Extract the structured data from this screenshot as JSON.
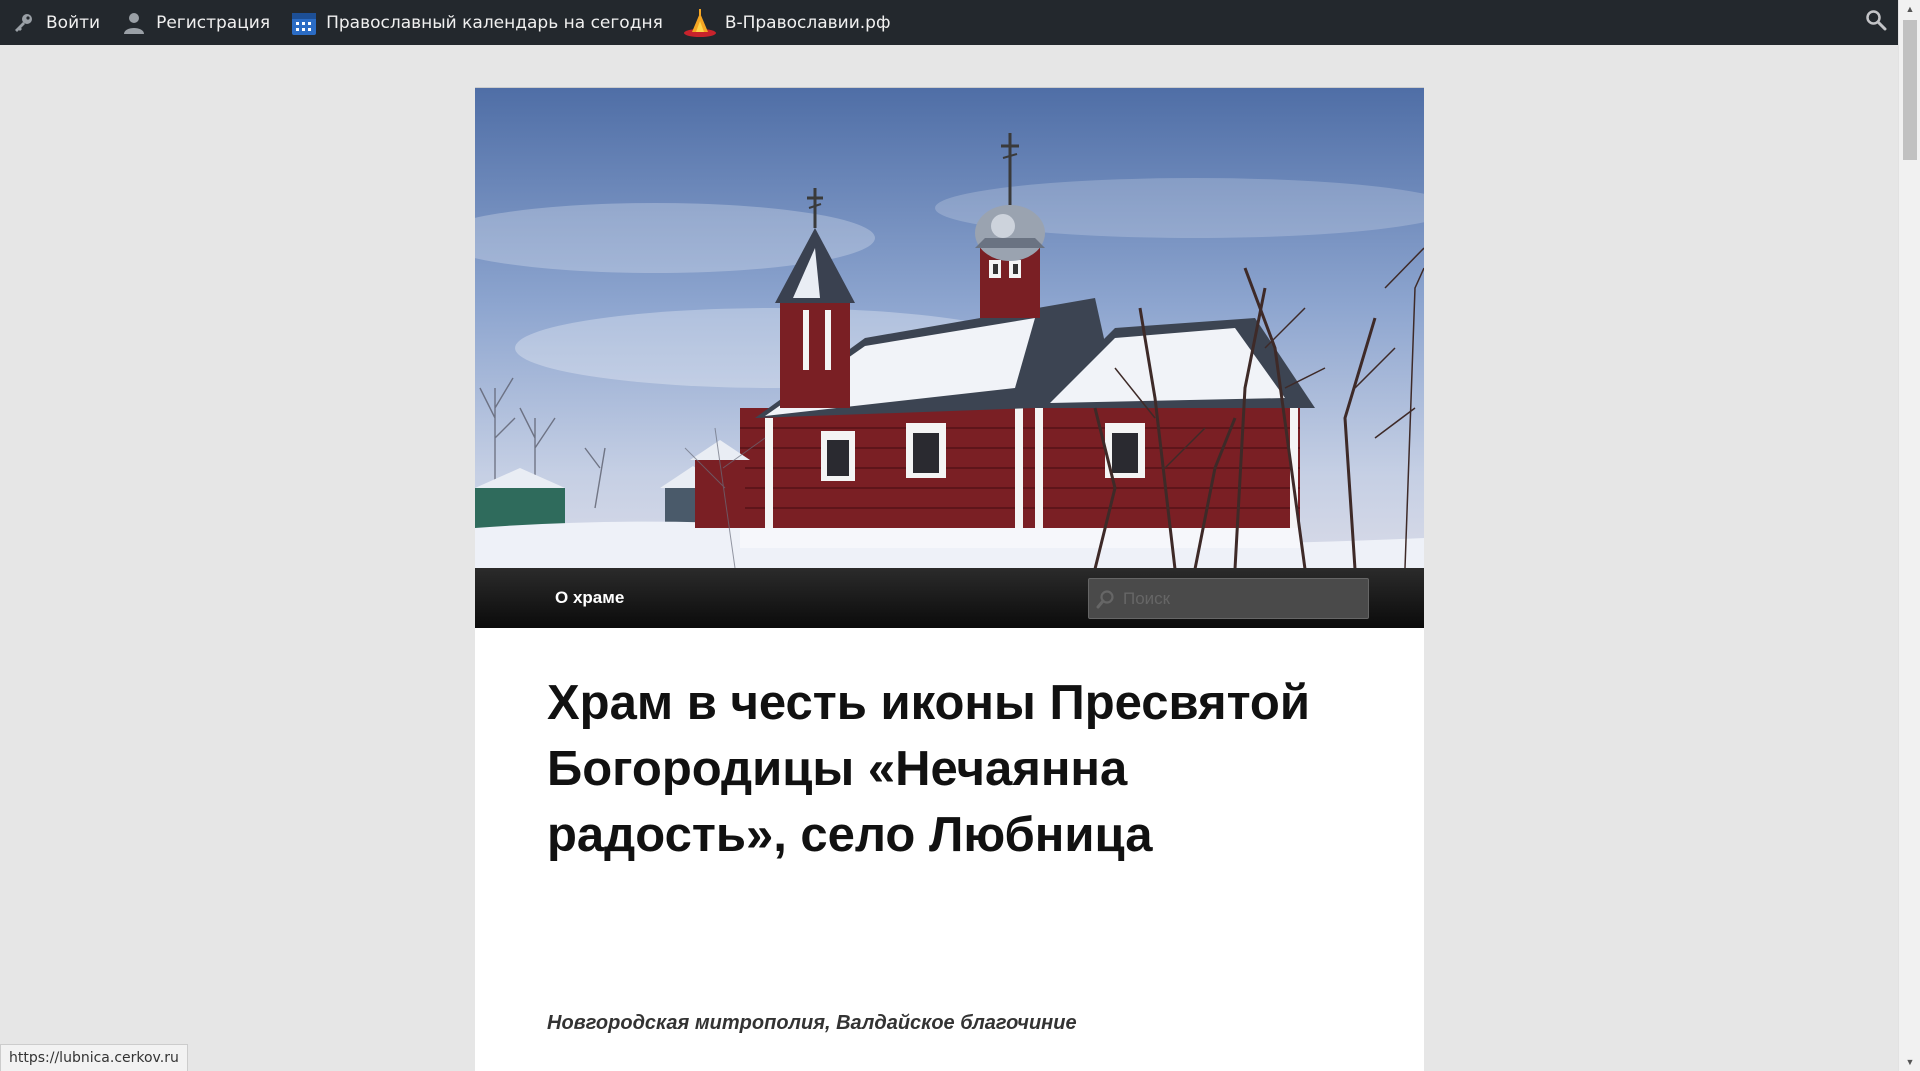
{
  "adminbar": {
    "login": "Войти",
    "register": "Регистрация",
    "calendar": "Православный календарь на сегодня",
    "site": "В-Православии.рф",
    "icons": [
      "key-icon",
      "user-icon",
      "calendar-icon",
      "church-logo-icon",
      "search-icon"
    ]
  },
  "nav": {
    "items": [
      {
        "label": "О храме"
      }
    ],
    "search_placeholder": "Поиск"
  },
  "main": {
    "title": "Храм в честь иконы Пресвятой Богородицы «Нечаянна радость», село Любница",
    "subtitle": "Новгородская митрополия, Валдайское благочиние"
  },
  "status": {
    "url": "https://lubnica.cerkov.ru"
  },
  "colors": {
    "adminbar_bg": "#23282d",
    "page_bg": "#e6e6e6",
    "nav_bg": "#111111",
    "church_red": "#7a1f24"
  }
}
